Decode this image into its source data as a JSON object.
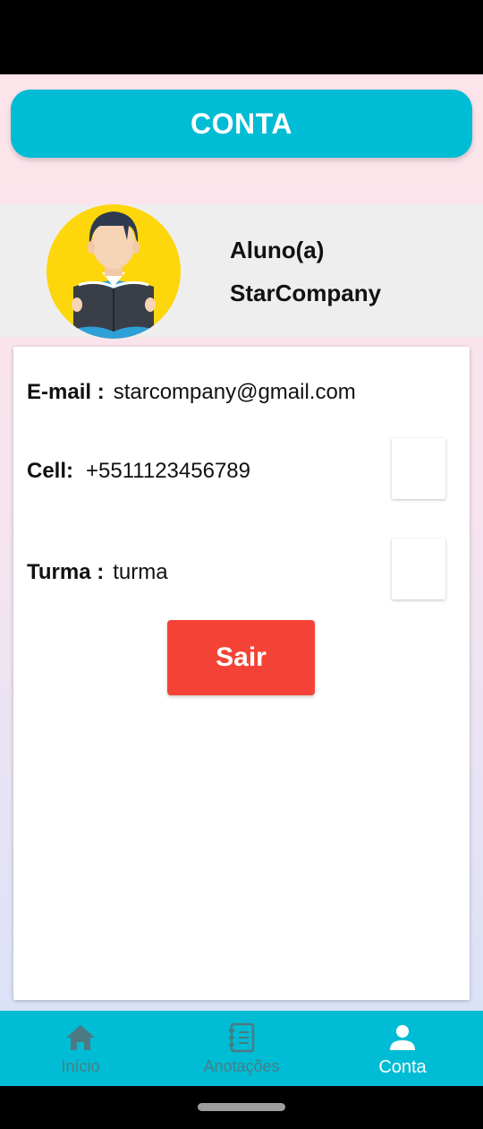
{
  "header": {
    "title": "CONTA"
  },
  "profile": {
    "role": "Aluno(a)",
    "name": "StarCompany"
  },
  "info": {
    "email_label": "E-mail :",
    "email_value": "starcompany@gmail.com",
    "cell_label": "Cell:",
    "cell_value": "+5511123456789",
    "turma_label": "Turma :",
    "turma_value": "turma"
  },
  "actions": {
    "logout_label": "Sair"
  },
  "nav": {
    "items": [
      {
        "label": "Início",
        "icon": "home-icon",
        "active": false
      },
      {
        "label": "Anotações",
        "icon": "notebook-icon",
        "active": false
      },
      {
        "label": "Conta",
        "icon": "person-icon",
        "active": true
      }
    ]
  },
  "colors": {
    "accent": "#00bcd4",
    "logout": "#f44336",
    "avatar_bg": "#fdd60c"
  }
}
